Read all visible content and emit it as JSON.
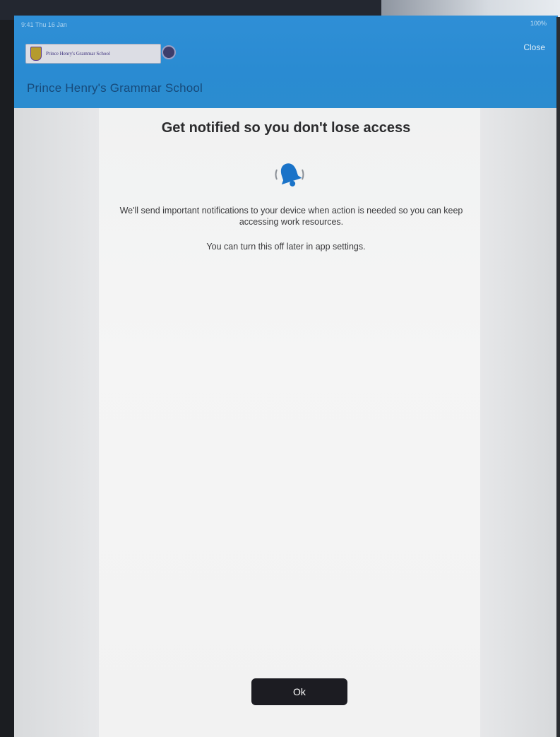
{
  "status_bar": {
    "left_text": "9:41 Thu 16 Jan",
    "right_text": "100%"
  },
  "header": {
    "logo_text": "Prince Henry's Grammar School",
    "close_label": "Close",
    "school_name": "Prince Henry's Grammar School",
    "background_color": "#2b8cd3"
  },
  "dialog": {
    "title": "Get notified so you don't lose access",
    "icon": "bell-icon",
    "icon_color": "#1a73c8",
    "description": "We'll send important notifications to your device when action is needed so you can keep accessing work resources.",
    "hint": "You can turn this off later in app settings.",
    "ok_label": "Ok"
  }
}
